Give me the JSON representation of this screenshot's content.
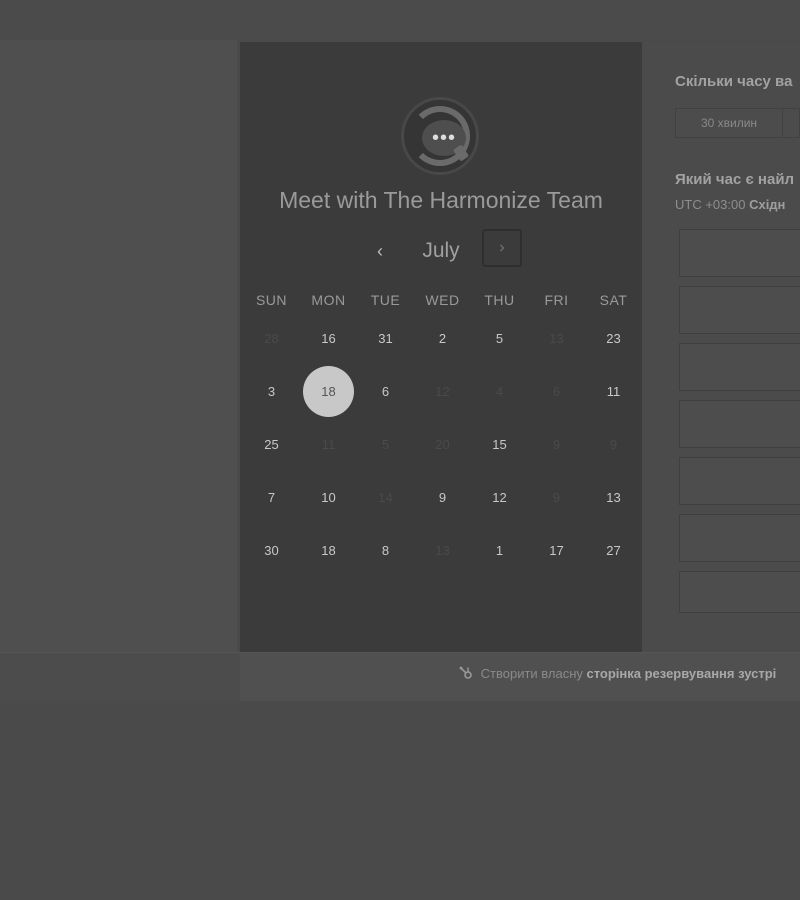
{
  "calendar": {
    "title": "Meet with The Harmonize Team",
    "month": "July",
    "prev_icon": "‹",
    "next_icon": "›",
    "weekdays": [
      "SUN",
      "MON",
      "TUE",
      "WED",
      "THU",
      "FRI",
      "SAT"
    ],
    "weeks": [
      [
        {
          "d": "28",
          "on": false
        },
        {
          "d": "16",
          "on": true
        },
        {
          "d": "31",
          "on": true
        },
        {
          "d": "2",
          "on": true
        },
        {
          "d": "5",
          "on": true
        },
        {
          "d": "13",
          "on": false
        },
        {
          "d": "23",
          "on": true
        }
      ],
      [
        {
          "d": "3",
          "on": true
        },
        {
          "d": "18",
          "on": true,
          "sel": true
        },
        {
          "d": "6",
          "on": true
        },
        {
          "d": "12",
          "on": false
        },
        {
          "d": "4",
          "on": false
        },
        {
          "d": "6",
          "on": false
        },
        {
          "d": "11",
          "on": true
        }
      ],
      [
        {
          "d": "25",
          "on": true
        },
        {
          "d": "11",
          "on": false
        },
        {
          "d": "5",
          "on": false
        },
        {
          "d": "20",
          "on": false
        },
        {
          "d": "15",
          "on": true
        },
        {
          "d": "9",
          "on": false
        },
        {
          "d": "9",
          "on": false
        }
      ],
      [
        {
          "d": "7",
          "on": true
        },
        {
          "d": "10",
          "on": true
        },
        {
          "d": "14",
          "on": false
        },
        {
          "d": "9",
          "on": true
        },
        {
          "d": "12",
          "on": true
        },
        {
          "d": "9",
          "on": false
        },
        {
          "d": "13",
          "on": true
        }
      ],
      [
        {
          "d": "30",
          "on": true
        },
        {
          "d": "18",
          "on": true
        },
        {
          "d": "8",
          "on": true
        },
        {
          "d": "13",
          "on": false
        },
        {
          "d": "1",
          "on": true
        },
        {
          "d": "17",
          "on": true
        },
        {
          "d": "27",
          "on": true
        }
      ]
    ]
  },
  "booking": {
    "duration_question": "Скільки часу ва",
    "duration_option": "30 хвилин",
    "time_question": "Який час є найл",
    "timezone_prefix": "UTC +03:00 ",
    "timezone_bold": "Східн",
    "slots": [
      "",
      "",
      "",
      "",
      "",
      "",
      ""
    ]
  },
  "footer": {
    "link_prefix": "Створити власну ",
    "link_bold": "сторінка резервування зустрі",
    "icon": "sprocket-icon"
  }
}
